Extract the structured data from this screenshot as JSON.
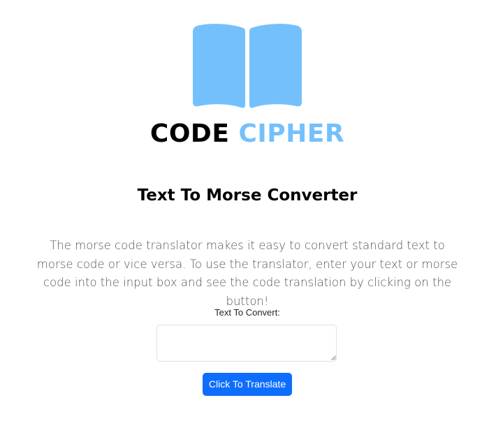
{
  "brand": {
    "word1": "CODE",
    "word2": "CIPHER",
    "icon": "open-book-icon",
    "accent_color": "#74c0fc"
  },
  "main": {
    "heading": "Text To Morse Converter",
    "description": "The morse code translator makes it easy to convert standard text to morse code or vice versa. To use the translator, enter your text or morse code into the input box and see the code translation by clicking on the button!"
  },
  "form": {
    "label": "Text To Convert:",
    "input_value": "",
    "button_label": "Click To Translate",
    "button_color": "#0d6efd"
  }
}
